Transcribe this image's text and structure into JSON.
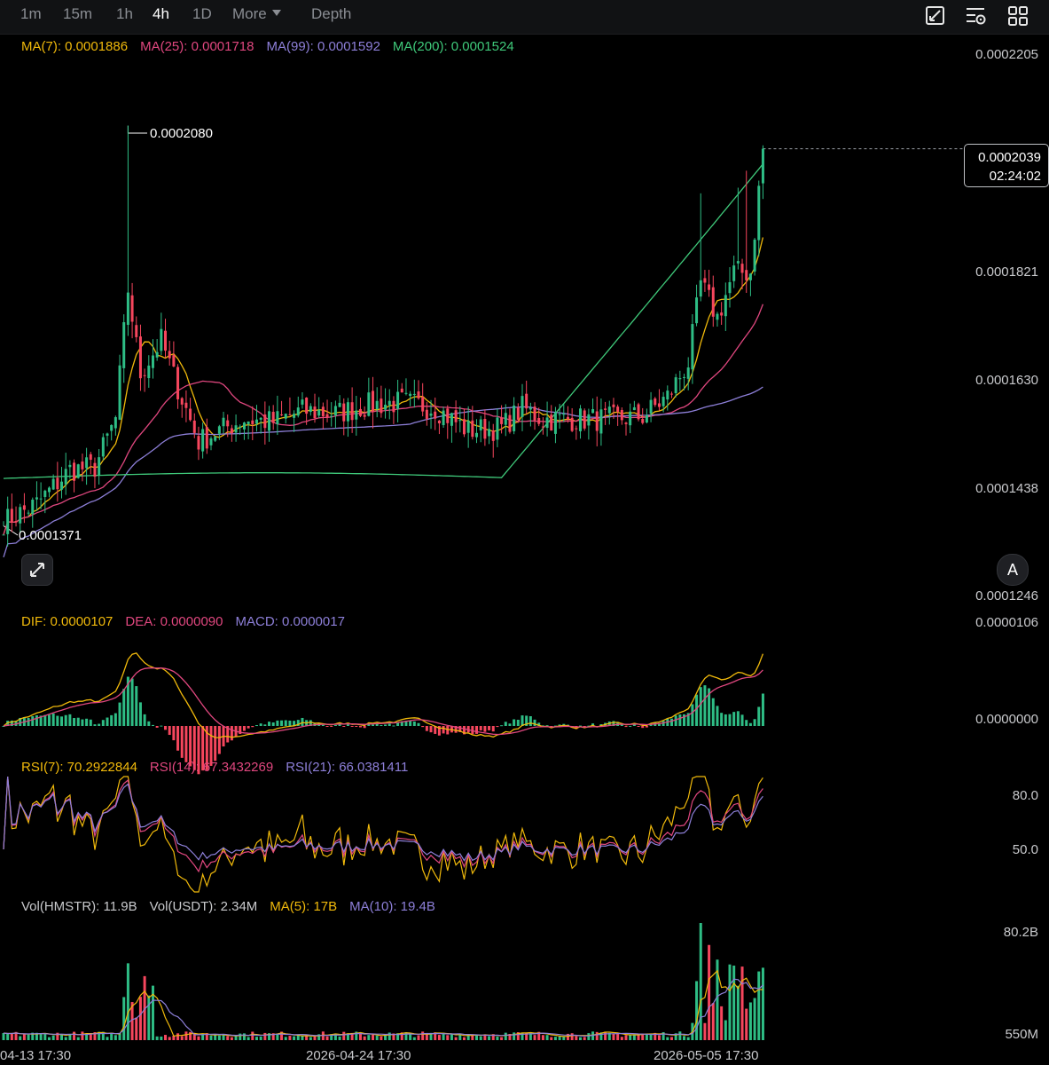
{
  "toolbar": {
    "timeframes": [
      "1m",
      "15m",
      "1h",
      "4h",
      "1D"
    ],
    "active": "4h",
    "more_label": "More",
    "depth_label": "Depth",
    "icons": [
      "chart-style-icon",
      "indicator-settings-icon",
      "grid-layout-icon"
    ]
  },
  "legends": {
    "ma": [
      {
        "text": "MA(7): 0.0001886",
        "color": "#f0b90b"
      },
      {
        "text": "MA(25): 0.0001718",
        "color": "#e0477f"
      },
      {
        "text": "MA(99): 0.0001592",
        "color": "#8d7fd8"
      },
      {
        "text": "MA(200): 0.0001524",
        "color": "#3fc97a"
      }
    ],
    "macd": [
      {
        "text": "DIF: 0.0000107",
        "color": "#f0b90b"
      },
      {
        "text": "DEA: 0.0000090",
        "color": "#e0477f"
      },
      {
        "text": "MACD: 0.0000017",
        "color": "#8d7fd8"
      }
    ],
    "rsi": [
      {
        "text": "RSI(7): 70.2922844",
        "color": "#f0b90b"
      },
      {
        "text": "RSI(14): 67.3432269",
        "color": "#e0477f"
      },
      {
        "text": "RSI(21): 66.0381411",
        "color": "#8d7fd8"
      }
    ],
    "vol": [
      {
        "text": "Vol(HMSTR): 11.9B",
        "color": "#c8c9cc"
      },
      {
        "text": "Vol(USDT): 2.34M",
        "color": "#c8c9cc"
      },
      {
        "text": "MA(5): 17B",
        "color": "#f0b90b"
      },
      {
        "text": "MA(10): 19.4B",
        "color": "#8d7fd8"
      }
    ]
  },
  "price_axis": [
    "0.0002205",
    "0.0001821",
    "0.0001630",
    "0.0001438",
    "0.0001246"
  ],
  "macd_axis": [
    "0.0000106",
    "0.0000000"
  ],
  "rsi_axis": [
    "80.0",
    "50.0"
  ],
  "vol_axis": [
    "80.2B",
    "550M"
  ],
  "current_price": {
    "price": "0.0002039",
    "countdown": "02:24:02"
  },
  "annotations": {
    "high": "0.0002080",
    "low": "0.0001371"
  },
  "x_labels": [
    "04-13 17:30",
    "2026-04-24 17:30",
    "2026-05-05 17:30"
  ],
  "buttons": {
    "auto_label": "A",
    "expand_icon": "expand-icon"
  },
  "colors": {
    "up": "#2ebd85",
    "down": "#f6465d",
    "ma7": "#f0b90b",
    "ma25": "#e0477f",
    "ma99": "#8d7fd8",
    "ma200": "#3fc97a"
  },
  "chart_data": {
    "type": "candlestick",
    "price_anchors": [
      [
        0,
        0.0001378
      ],
      [
        8,
        0.000141
      ],
      [
        16,
        0.000147
      ],
      [
        22,
        0.0001475
      ],
      [
        27,
        0.000156
      ],
      [
        30,
        0.000179
      ],
      [
        33,
        0.000164
      ],
      [
        38,
        0.00017
      ],
      [
        42,
        0.0001615
      ],
      [
        47,
        0.000152
      ],
      [
        52,
        0.000154
      ],
      [
        58,
        0.000156
      ],
      [
        65,
        0.0001555
      ],
      [
        72,
        0.0001575
      ],
      [
        80,
        0.000157
      ],
      [
        88,
        0.0001585
      ],
      [
        96,
        0.000159
      ],
      [
        104,
        0.000158
      ],
      [
        112,
        0.000154
      ],
      [
        120,
        0.0001545
      ],
      [
        125,
        0.000158
      ],
      [
        130,
        0.000156
      ],
      [
        138,
        0.000156
      ],
      [
        146,
        0.000156
      ],
      [
        154,
        0.0001565
      ],
      [
        160,
        0.00016
      ],
      [
        165,
        0.000166
      ],
      [
        168,
        0.00018
      ],
      [
        172,
        0.000174
      ],
      [
        176,
        0.000182
      ],
      [
        180,
        0.000182
      ],
      [
        183,
        0.0002039
      ]
    ]
  }
}
